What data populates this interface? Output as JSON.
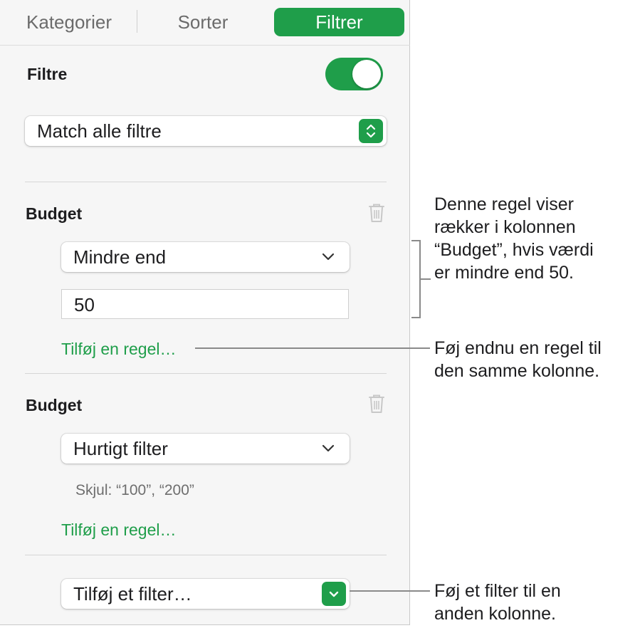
{
  "tabs": [
    {
      "label": "Kategorier",
      "active": false
    },
    {
      "label": "Sorter",
      "active": false
    },
    {
      "label": "Filtrer",
      "active": true
    }
  ],
  "filters": {
    "title": "Filtre",
    "enabled": true,
    "match_mode": "Match alle filtre"
  },
  "rule_groups": [
    {
      "column": "Budget",
      "condition": "Mindre end",
      "value": "50",
      "add_rule_label": "Tilføj en regel…"
    },
    {
      "column": "Budget",
      "condition": "Hurtigt filter",
      "hidden_note": "Skjul: “100”, “200”",
      "add_rule_label": "Tilføj en regel…"
    }
  ],
  "add_filter_label": "Tilføj et filter…",
  "callouts": [
    {
      "lines": [
        "Denne regel viser",
        "rækker i kolonnen",
        "“Budget”, hvis værdi",
        "er mindre end 50."
      ]
    },
    {
      "lines": [
        "Føj endnu en regel til",
        "den samme kolonne."
      ]
    },
    {
      "lines": [
        "Føj et filter til en",
        "anden kolonne."
      ]
    }
  ],
  "colors": {
    "accent": "#1f9e4a",
    "panel_bg": "#f6f6f6",
    "link": "#1f9e4a"
  },
  "icons": [
    "trash-icon",
    "chevron-down-icon",
    "stepper-icon"
  ]
}
